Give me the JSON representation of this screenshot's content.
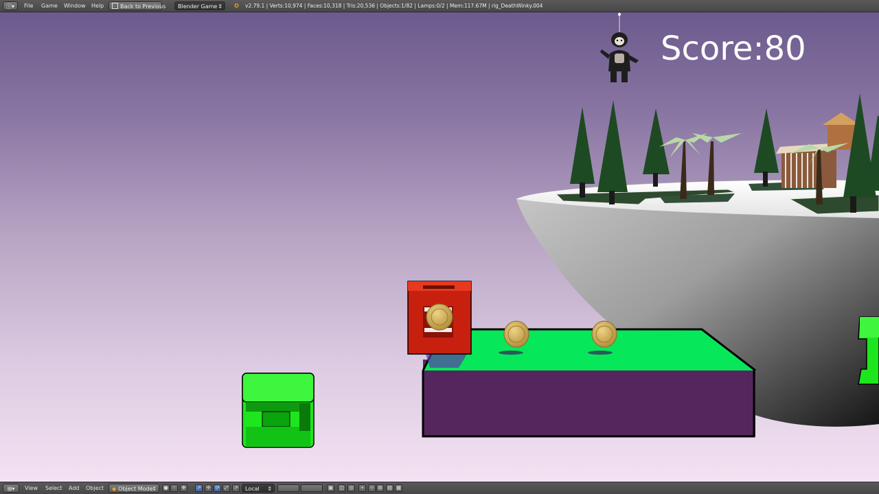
{
  "top_bar": {
    "menu": [
      "File",
      "Game",
      "Window",
      "Help"
    ],
    "back_button": "Back to Previous",
    "engine_select": "Blender Game",
    "stats": "v2.79.1 | Verts:10,974 | Faces:10,318 | Tris:20,536 | Objects:1/82 | Lamps:0/2 | Mem:117.67M | rig_DeathWinky.004"
  },
  "game": {
    "score_label": "Score:",
    "score_value": "80"
  },
  "bottom_bar": {
    "menu": [
      "View",
      "Select",
      "Add",
      "Object"
    ],
    "mode_select": "Object Mode",
    "orientation_select": "Local"
  },
  "colors": {
    "platform_top": "#06e85a",
    "platform_side": "#55265e",
    "crate": "#c8200e",
    "coin": "#d4b050",
    "block": "#1ee61e"
  }
}
